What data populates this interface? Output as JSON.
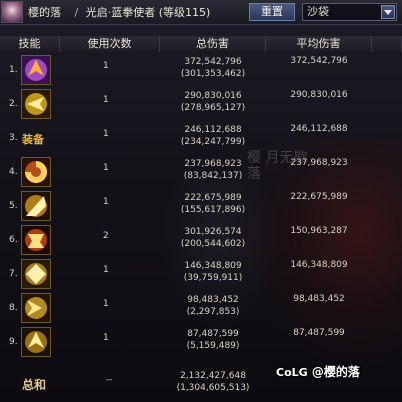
{
  "header": {
    "player_name": "樱的落",
    "separator": "/",
    "class_info": "光启·蓝拳使者 (等级115)",
    "reset_label": "重置",
    "dropdown_value": "沙袋"
  },
  "columns": {
    "skill": "技能",
    "count": "使用次数",
    "total": "总伤害",
    "avg": "平均伤害"
  },
  "rows": [
    {
      "rank": "1.",
      "icon": "skill-icon-purple-burst",
      "count": "1",
      "total": "372,542,796",
      "total_sub": "(301,353,462)",
      "avg": "372,542,796",
      "colors": [
        "#3a1050",
        "#c060e0",
        "#ffb040"
      ]
    },
    {
      "rank": "2.",
      "icon": "skill-icon-yellow-fist",
      "count": "1",
      "total": "290,830,016",
      "total_sub": "(278,965,127)",
      "avg": "290,830,016",
      "colors": [
        "#2a1808",
        "#f0c020",
        "#fff0a0"
      ]
    },
    {
      "rank": "3.",
      "label": "装备",
      "count": "1",
      "total": "246,112,688",
      "total_sub": "(234,247,799)",
      "avg": "246,112,688"
    },
    {
      "rank": "4.",
      "icon": "skill-icon-flame-slash",
      "count": "1",
      "total": "237,968,923",
      "total_sub": "(83,842,137)",
      "avg": "237,968,923",
      "colors": [
        "#2a1006",
        "#e06020",
        "#ffd060"
      ]
    },
    {
      "rank": "5.",
      "icon": "skill-icon-gold-swirl",
      "count": "1",
      "total": "222,675,989",
      "total_sub": "(155,617,896)",
      "avg": "222,675,989",
      "colors": [
        "#201006",
        "#e0a020",
        "#fff4b0"
      ]
    },
    {
      "rank": "6.",
      "icon": "skill-icon-fire-strike",
      "count": "2",
      "total": "301,926,574",
      "total_sub": "(200,544,602)",
      "avg": "150,963,287",
      "colors": [
        "#1e0c04",
        "#d85018",
        "#ffe080"
      ]
    },
    {
      "rank": "7.",
      "icon": "skill-icon-gold-fist",
      "count": "1",
      "total": "146,348,809",
      "total_sub": "(39,759,911)",
      "avg": "146,348,809",
      "colors": [
        "#2a1a06",
        "#d0a030",
        "#fff0b0"
      ]
    },
    {
      "rank": "8.",
      "icon": "skill-icon-golden-blaze",
      "count": "1",
      "total": "98,483,452",
      "total_sub": "(2,297,853)",
      "avg": "98,483,452",
      "colors": [
        "#241406",
        "#e0b030",
        "#ffe890"
      ]
    },
    {
      "rank": "9.",
      "icon": "skill-icon-gold-arrow",
      "count": "1",
      "total": "87,487,599",
      "total_sub": "(5,159,489)",
      "avg": "87,487,599",
      "colors": [
        "#1a1004",
        "#c89020",
        "#fff0a0"
      ]
    }
  ],
  "summary": {
    "label": "总和",
    "count": "--",
    "total": "2,132,427,648",
    "total_sub": "(1,304,605,513)"
  },
  "watermark": {
    "brand": "CoLG",
    "handle": "@樱的落"
  },
  "overlay": {
    "line1": "樱  月无歇",
    "line2": "   落"
  }
}
